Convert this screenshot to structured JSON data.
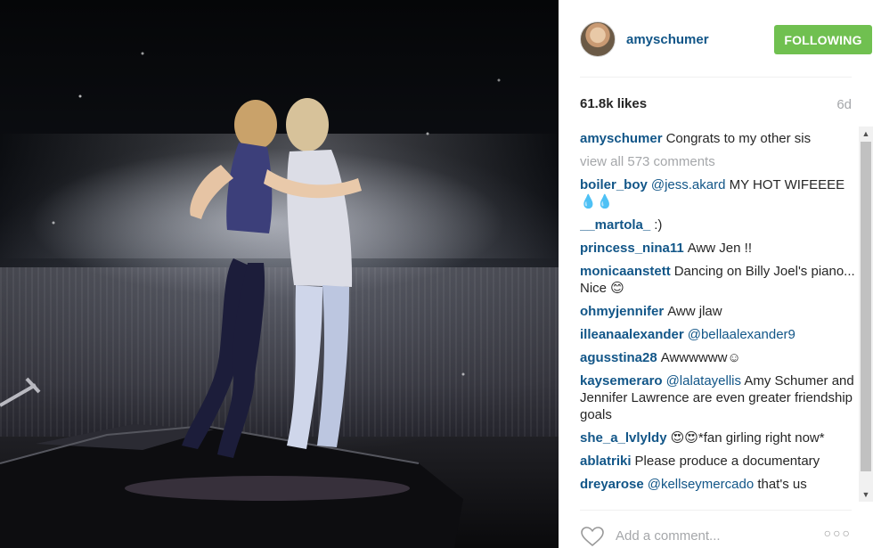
{
  "post": {
    "photo_alt": "",
    "username": "amyschumer",
    "follow_label": "FOLLOWING",
    "likes": "61.8k likes",
    "age": "6d",
    "caption": {
      "author": "amyschumer",
      "text": "Congrats to my other sis"
    },
    "view_all": "view all 573 comments",
    "comments": [
      {
        "author": "boiler_boy",
        "mention": "@jess.akard",
        "text": "MY HOT WIFEEEE 💧💧"
      },
      {
        "author": "__martola_",
        "mention": "",
        "text": ":)"
      },
      {
        "author": "princess_nina11",
        "mention": "",
        "text": "Aww Jen !!"
      },
      {
        "author": "monicaanstett",
        "mention": "",
        "text": "Dancing on Billy Joel's piano... Nice 😊"
      },
      {
        "author": "ohmyjennifer",
        "mention": "",
        "text": "Aww jlaw"
      },
      {
        "author": "illeanaalexander",
        "mention": "@bellaalexander9",
        "text": ""
      },
      {
        "author": "agusstina28",
        "mention": "",
        "text": "Awwwwww☺"
      },
      {
        "author": "kaysemeraro",
        "mention": "@lalatayellis",
        "text": "Amy Schumer and Jennifer Lawrence are even greater friendship goals"
      },
      {
        "author": "she_a_lvlyldy",
        "mention": "",
        "text": "😍😍*fan girling right now*"
      },
      {
        "author": "ablatriki",
        "mention": "",
        "text": "Please produce a documentary"
      },
      {
        "author": "dreyarose",
        "mention": "@kellseymercado",
        "text": "that's us"
      }
    ],
    "add_comment_placeholder": "Add a comment...",
    "more_label": "○○○"
  },
  "icons": {
    "heart": "heart-icon",
    "more": "more-options-icon",
    "scroll_up": "▲",
    "scroll_down": "▼"
  },
  "colors": {
    "link_blue": "#125688",
    "follow_green": "#70c050",
    "muted_gray": "#a5a7aa"
  }
}
